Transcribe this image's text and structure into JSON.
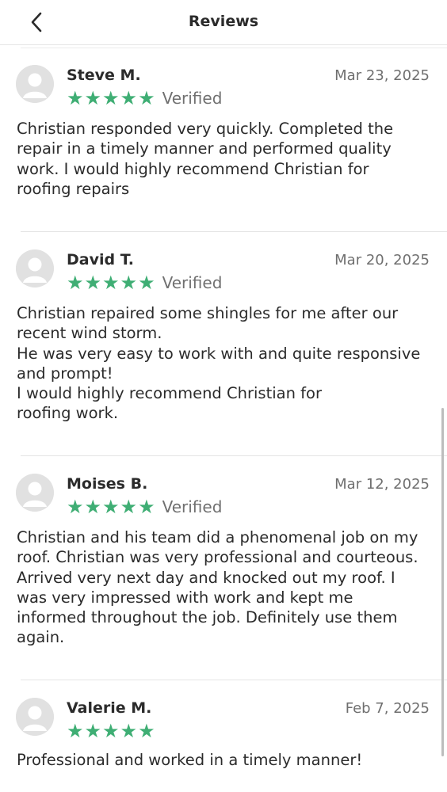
{
  "header": {
    "title": "Reviews"
  },
  "reviews": [
    {
      "name": "Steve M.",
      "date": "Mar 23, 2025",
      "rating": 5,
      "verified_label": "Verified",
      "text": "Christian responded very quickly. Completed the\nrepair in a timely manner and performed quality\nwork. I would highly recommend Christian for\nroofing repairs"
    },
    {
      "name": "David T.",
      "date": "Mar 20, 2025",
      "rating": 5,
      "verified_label": "Verified",
      "text": "Christian repaired some shingles for me after our\nrecent wind storm.\nHe was very easy to work with and quite responsive\nand prompt!\nI would highly recommend Christian for\nroofing work."
    },
    {
      "name": "Moises B.",
      "date": "Mar 12, 2025",
      "rating": 5,
      "verified_label": "Verified",
      "text": "Christian and his team did a phenomenal job on my\nroof.  Christian was very professional and courteous.\nArrived very next day and knocked out my roof. I\nwas very impressed with work and kept me\ninformed throughout the job. Definitely use them\nagain."
    },
    {
      "name": "Valerie M.",
      "date": "Feb 7, 2025",
      "rating": 5,
      "verified_label": "",
      "text": "Professional and worked in a timely manner!"
    }
  ],
  "colors": {
    "star": "#3fae74",
    "avatar": "#e1e1e1"
  },
  "icons": {
    "back": "chevron-left-icon",
    "avatar": "user-silhouette-icon",
    "star": "star-icon"
  }
}
